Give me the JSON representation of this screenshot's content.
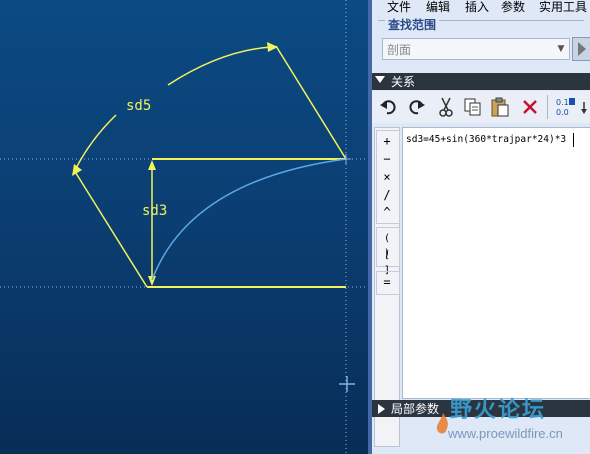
{
  "canvas": {
    "dimensions": [
      {
        "label": "sd5"
      },
      {
        "label": "sd3"
      }
    ]
  },
  "menubar": {
    "items": [
      "文件",
      "编辑",
      "插入",
      "参数",
      "实用工具"
    ]
  },
  "find": {
    "title": "查找范围",
    "value": "剖面"
  },
  "relations": {
    "header": "关系",
    "toolbar_icons": [
      "undo-icon",
      "redo-icon",
      "cut-icon",
      "copy-icon",
      "paste-icon",
      "delete-icon",
      "sort-icon",
      "expand-icon"
    ],
    "operators": [
      "+",
      "−",
      "×",
      "/",
      "^"
    ],
    "grouping": [
      "( )",
      "[ ]"
    ],
    "equals": "=",
    "text": "sd3=45+sin(360*trajpar*24)*3"
  },
  "local_params": {
    "header": "局部参数"
  },
  "watermark": {
    "title": "野火论坛",
    "url": "www.proewildfire.cn"
  },
  "colors": {
    "dimension": "#f2f25a",
    "curve": "#5ba7e8",
    "canvas_top": "#0b4a83",
    "canvas_bottom": "#082d57",
    "panel": "#dfe8f6",
    "header_dark": "#2b3540"
  }
}
